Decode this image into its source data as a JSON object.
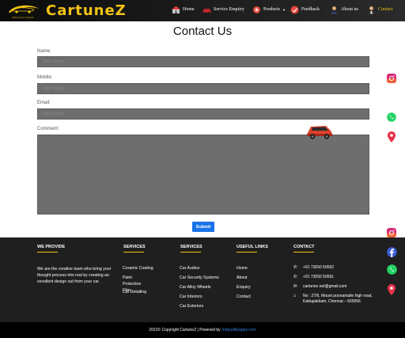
{
  "brand": {
    "name": "CartuneZ",
    "badge_text": "Welcome to Cartunez"
  },
  "nav": [
    {
      "label": "Home",
      "icon": "home-icon",
      "active": false
    },
    {
      "label": "Service Enquiry",
      "icon": "car-icon",
      "active": false
    },
    {
      "label": "Products",
      "icon": "products-icon",
      "active": false,
      "dropdown": true
    },
    {
      "label": "Feedback",
      "icon": "feedback-icon",
      "active": false
    },
    {
      "label": "About us",
      "icon": "about-icon",
      "active": false
    },
    {
      "label": "Contact",
      "icon": "contact-icon",
      "active": true
    }
  ],
  "page_title": "Contact Us",
  "form": {
    "name_label": "Name:",
    "name_placeholder": "Enter Name",
    "mobile_label": "Mobile:",
    "mobile_placeholder": "Enter Mobile",
    "email_label": "Email:",
    "email_placeholder": "Enter Email",
    "comment_label": "Comment:",
    "submit_label": "Submit"
  },
  "footer": {
    "provide_heading": "WE PROVIDE",
    "provide_text": "We are the creative team who bring your thought process into real by creating an excellent design out from your car.",
    "services1_heading": "SERVICES",
    "services1": [
      "Ceramic Coating",
      "Paint Protection Film",
      "Car Detailing"
    ],
    "services2_heading": "SERVICES",
    "services2": [
      "Car Audios",
      "Car Security Systems",
      "Car Alloy Wheels",
      "Car Interiors",
      "Car Exteriors"
    ],
    "links_heading": "USEFUL LINKS",
    "links": [
      "Home",
      "About",
      "Enquiry",
      "Contact"
    ],
    "contact_heading": "CONTACT",
    "phone1": "+91 73050 50592",
    "phone2": "+91 73050 50591",
    "email": "cartunez.net@gmail.com",
    "address": "No : 27/6, Mount poonamalle high road, Kattupakkam, Chennai – 600056"
  },
  "copyright": {
    "text": "2021© Copyright CartuneZ | Powered by",
    "link": "mdqualityapps.com"
  },
  "colors": {
    "accent": "#f3c316",
    "submit": "#1a73e8",
    "footer_bg": "#1f1f1f",
    "field_bg": "#6e6e6e"
  }
}
